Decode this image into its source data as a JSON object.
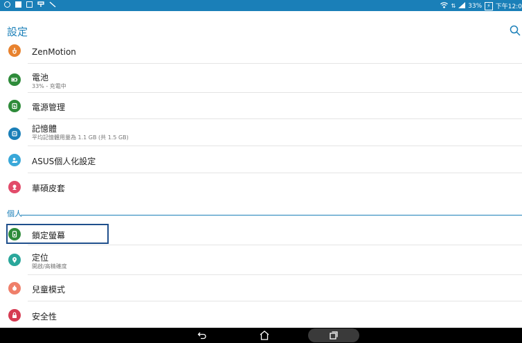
{
  "status_bar": {
    "battery_percent": "33%",
    "time": "下午12:0"
  },
  "app_bar": {
    "title": "設定"
  },
  "settings": [
    {
      "id": "zenmotion",
      "title": "ZenMotion",
      "subtitle": "",
      "color": "#e8822e",
      "icon": "hand-icon"
    },
    {
      "id": "battery",
      "title": "電池",
      "subtitle": "33% - 充電中",
      "color": "#2e8b3a",
      "icon": "battery-icon"
    },
    {
      "id": "power",
      "title": "電源管理",
      "subtitle": "",
      "color": "#2e8b3a",
      "icon": "power-management-icon"
    },
    {
      "id": "memory",
      "title": "記憶體",
      "subtitle": "平均記憶體用量為 1.1 GB (共 1.5 GB)",
      "color": "#1a7fb8",
      "icon": "memory-icon"
    },
    {
      "id": "asus-custom",
      "title": "ASUS個人化設定",
      "subtitle": "",
      "color": "#39a8d9",
      "icon": "person-gear-icon"
    },
    {
      "id": "cover",
      "title": "華碩皮套",
      "subtitle": "",
      "color": "#e24b6a",
      "icon": "cover-icon"
    }
  ],
  "section_personal": {
    "label": "個人"
  },
  "personal_settings": [
    {
      "id": "lock-screen",
      "title": "鎖定螢幕",
      "subtitle": "",
      "color": "#2e8b3a",
      "icon": "lock-screen-icon"
    },
    {
      "id": "location",
      "title": "定位",
      "subtitle": "開啟/高精確度",
      "color": "#2aa79b",
      "icon": "location-pin-icon"
    },
    {
      "id": "kids-mode",
      "title": "兒童模式",
      "subtitle": "",
      "color": "#ef7f6a",
      "icon": "kids-mode-icon"
    },
    {
      "id": "security",
      "title": "安全性",
      "subtitle": "",
      "color": "#d63b52",
      "icon": "lock-icon"
    }
  ],
  "colors": {
    "accent": "#1a7fb8",
    "focus_border": "#1f4f8c"
  }
}
